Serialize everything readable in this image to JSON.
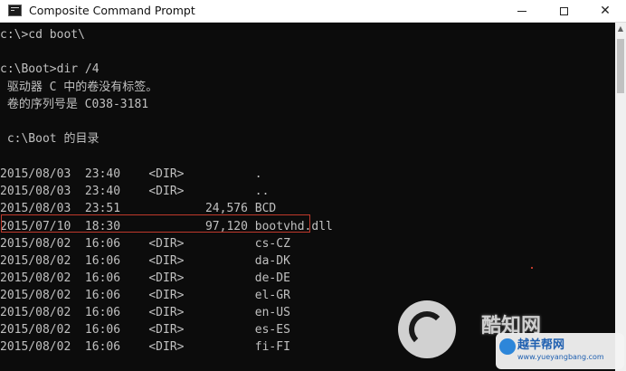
{
  "window": {
    "title": "Composite Command Prompt",
    "icon": "cmd-icon",
    "controls": {
      "minimize": "minimize",
      "maximize": "maximize",
      "close": "✕"
    }
  },
  "console": {
    "lines": [
      "c:\\>cd boot\\",
      "",
      "c:\\Boot>dir /4",
      " 驱动器 C 中的卷没有标签。",
      " 卷的序列号是 C038-3181",
      "",
      " c:\\Boot 的目录",
      "",
      "2015/08/03  23:40    <DIR>          .",
      "2015/08/03  23:40    <DIR>          ..",
      "2015/08/03  23:51            24,576 BCD",
      "2015/07/10  18:30            97,120 bootvhd.dll",
      "2015/08/02  16:06    <DIR>          cs-CZ",
      "2015/08/02  16:06    <DIR>          da-DK",
      "2015/08/02  16:06    <DIR>          de-DE",
      "2015/08/02  16:06    <DIR>          el-GR",
      "2015/08/02  16:06    <DIR>          en-US",
      "2015/08/02  16:06    <DIR>          es-ES",
      "2015/08/02  16:06    <DIR>          fi-FI"
    ],
    "highlighted_line": "2015/08/03  23:51            24,576 BCD",
    "text_color": "#c0c0c0",
    "background": "#0c0c0c"
  },
  "highlight_color": "#c0392b",
  "watermark": {
    "brand1": "酷知网",
    "brand2": "越羊帮网",
    "url": "www.yueyangbang.com"
  }
}
